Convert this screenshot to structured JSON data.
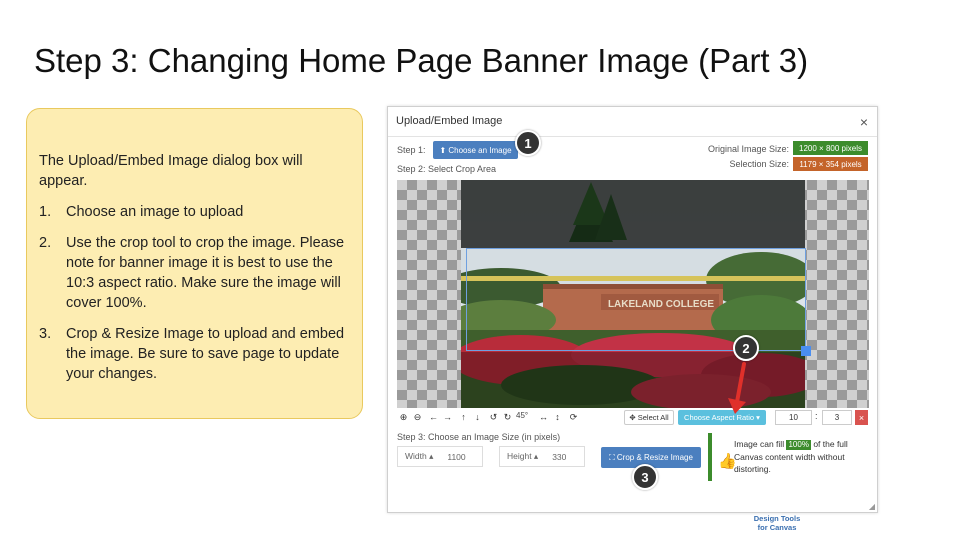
{
  "slide": {
    "title": "Step 3: Changing Home Page Banner Image (Part 3)"
  },
  "note": {
    "intro": "The Upload/Embed Image dialog box will appear.",
    "items": [
      {
        "num": "1.",
        "text": "Choose an image to upload"
      },
      {
        "num": "2.",
        "text": "Use the crop tool to crop the image. Please note for banner image it is best to use the 10:3 aspect ratio. Make sure the image will cover 100%."
      },
      {
        "num": "3.",
        "text": "Crop & Resize Image to upload and embed the image. Be sure to save page to update your changes."
      }
    ]
  },
  "dialog": {
    "title": "Upload/Embed Image",
    "close": "×",
    "step1_label": "Step 1:",
    "choose_button": "⬆ Choose an Image",
    "step2_label": "Step 2: Select Crop Area",
    "original_size_label": "Original Image Size:",
    "original_size_value": "1200 × 800 pixels",
    "selection_size_label": "Selection Size:",
    "selection_size_value": "1179 × 354 pixels",
    "photo_sign_text": "LAKELAND COLLEGE",
    "toolbar": {
      "zoom_in": "⊕",
      "zoom_out": "⊖",
      "left": "←",
      "right": "→",
      "up": "↑",
      "down": "↓",
      "rotate_ccw": "↺",
      "rotate_cw": "↻",
      "rotate_45": "45°",
      "flip_h": "↔",
      "flip_v": "↕",
      "reset": "⟳",
      "select_all": "✥ Select All",
      "aspect_ratio": "Choose Aspect Ratio ▾",
      "ratio_w": "10",
      "ratio_colon": ":",
      "ratio_h": "3",
      "ratio_clear": "×"
    },
    "step3_label": "Step 3: Choose an Image Size (in pixels)",
    "width_label": "Width ▴",
    "width_value": "1100",
    "height_label": "Height ▴",
    "height_value": "330",
    "crop_resize_button": "⛶ Crop & Resize Image",
    "info_prefix": "Image can fill",
    "info_badge": "100%",
    "info_suffix": "of the full Canvas content width without distorting.",
    "resize_grip": "◢"
  },
  "markers": {
    "m1": "1",
    "m2": "2",
    "m3": "3"
  },
  "brand": {
    "line1": "Design Tools",
    "line2": "for Canvas"
  },
  "colors": {
    "note_bg": "#fdedb2",
    "note_border": "#e9c95e",
    "button_blue": "#4b7fbf",
    "badge_green": "#3c8c2c",
    "badge_orange": "#c4642a",
    "aspect_cyan": "#5bc0de",
    "danger_red": "#d9534f",
    "arrow_red": "#e0302a"
  }
}
